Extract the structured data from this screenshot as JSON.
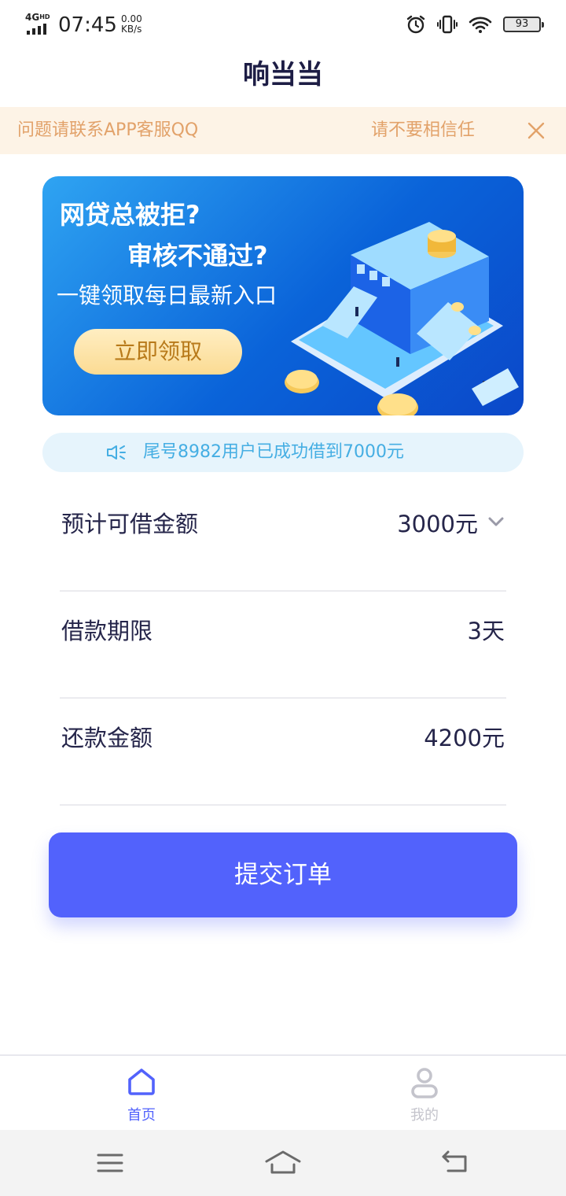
{
  "status_bar": {
    "network": "4G",
    "network_sup": "HD",
    "time": "07:45",
    "speed_value": "0.00",
    "speed_unit": "KB/s",
    "battery": "93",
    "icons": [
      "alarm-icon",
      "vibrate-icon",
      "wifi-icon",
      "battery-icon"
    ]
  },
  "header": {
    "title": "响当当"
  },
  "notice": {
    "text_1": "问题请联系APP客服QQ",
    "text_2": "请不要相信任",
    "close_icon": "close-icon"
  },
  "banner": {
    "line_1": "网贷总被拒?",
    "line_2": "审核不通过?",
    "line_3": "一键领取每日最新入口",
    "button": "立即领取"
  },
  "ticker": {
    "text": "尾号8982用户已成功借到7000元",
    "icon": "speaker-icon"
  },
  "loan": {
    "amount_label": "预计可借金额",
    "amount_value": "3000元",
    "term_label": "借款期限",
    "term_value": "3天",
    "repay_label": "还款金额",
    "repay_value": "4200元"
  },
  "submit_label": "提交订单",
  "tabbar": {
    "items": [
      {
        "label": "首页",
        "icon": "home-icon",
        "active": true
      },
      {
        "label": "我的",
        "icon": "user-icon",
        "active": false
      }
    ]
  },
  "colors": {
    "accent": "#5262fc",
    "notice_bg": "#fdf3e6",
    "notice_text": "#e2a26a",
    "ticker_text": "#45aee3",
    "banner_blue": "#0a63d9"
  }
}
